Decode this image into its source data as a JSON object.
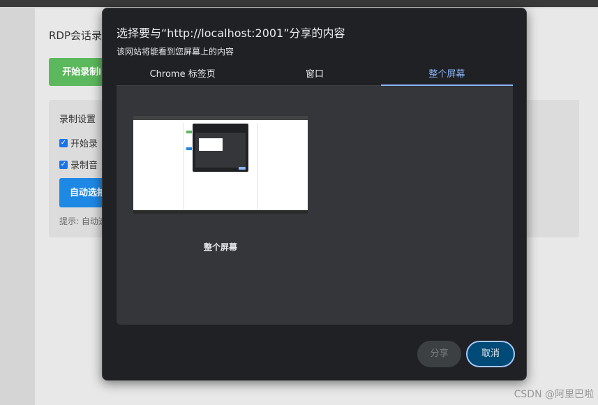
{
  "background_page": {
    "title": "RDP会话录",
    "start_button": "开始录制I",
    "settings_title": "录制设置",
    "checkbox_1": "开始录",
    "checkbox_2": "录制音",
    "auto_button": "自动选拍",
    "hint": "提示: 自动选",
    "watermark": "CSDN @阿里巴啦"
  },
  "dialog": {
    "title": "选择要与“http://localhost:2001”分享的内容",
    "subtitle": "该网站将能看到您屏幕上的内容",
    "tabs": [
      {
        "label": "Chrome 标签页",
        "active": false
      },
      {
        "label": "窗口",
        "active": false
      },
      {
        "label": "整个屏幕",
        "active": true
      }
    ],
    "screen_option_label": "整个屏幕",
    "buttons": {
      "share": "分享",
      "cancel": "取消"
    }
  },
  "colors": {
    "dialog_bg": "#202124",
    "content_bg": "#35363a",
    "accent": "#8ab4f8",
    "cancel_bg": "#004a77",
    "green_button": "#5cb85c",
    "blue_button": "#1e88e5"
  }
}
